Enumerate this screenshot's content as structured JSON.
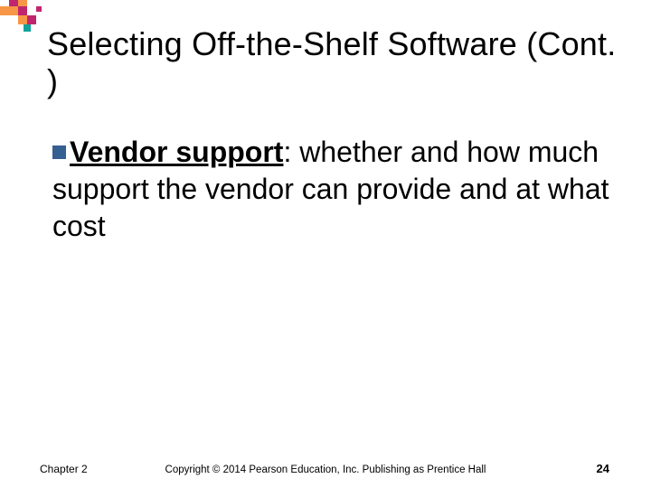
{
  "deco": {
    "colors": {
      "orange": "#f79646",
      "magenta": "#c0266e",
      "teal": "#12a19a"
    }
  },
  "title": "Selecting Off-the-Shelf Software (Cont. )",
  "body": {
    "bullet_bold": "Vendor support",
    "bullet_rest": ": whether and how much support the vendor can provide and at what cost"
  },
  "footer": {
    "chapter": "Chapter 2",
    "copyright": "Copyright © 2014 Pearson Education, Inc. Publishing as Prentice Hall",
    "page": "24"
  }
}
